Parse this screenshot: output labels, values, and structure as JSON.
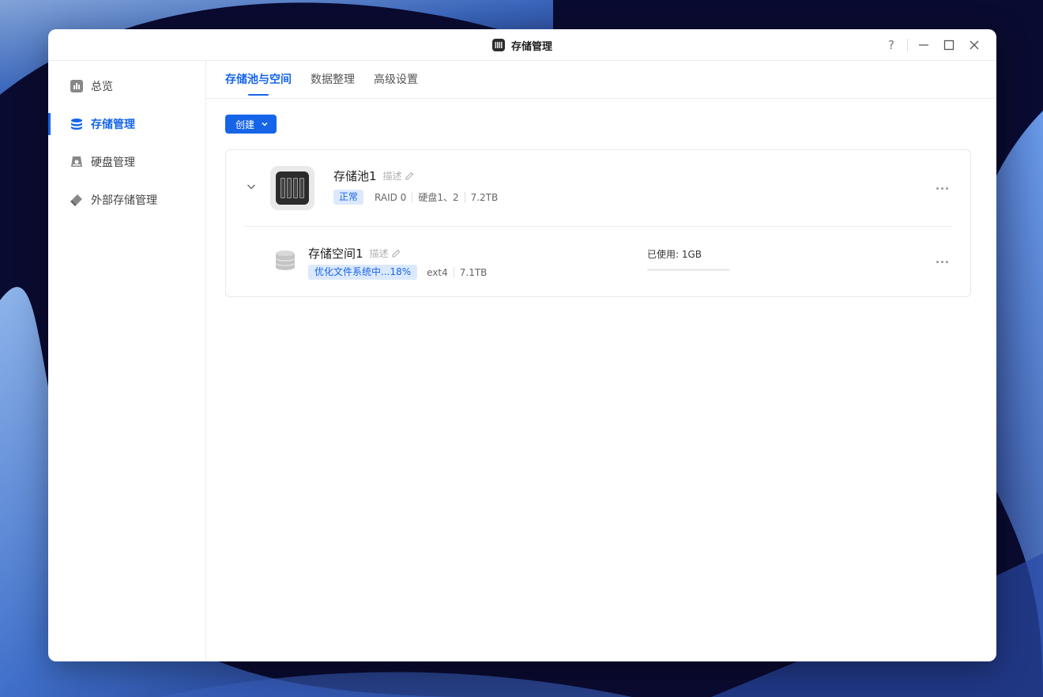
{
  "window": {
    "title": "存储管理",
    "controls": {
      "help": "?"
    }
  },
  "sidebar": {
    "items": [
      {
        "label": "总览",
        "icon": "chart-icon",
        "active": false
      },
      {
        "label": "存储管理",
        "icon": "database-icon",
        "active": true
      },
      {
        "label": "硬盘管理",
        "icon": "disk-icon",
        "active": false
      },
      {
        "label": "外部存储管理",
        "icon": "usb-icon",
        "active": false
      }
    ]
  },
  "tabs": [
    {
      "label": "存储池与空间",
      "active": true
    },
    {
      "label": "数据整理",
      "active": false
    },
    {
      "label": "高级设置",
      "active": false
    }
  ],
  "toolbar": {
    "create_label": "创建"
  },
  "pool": {
    "name": "存储池1",
    "desc_label": "描述",
    "status": "正常",
    "raid": "RAID 0",
    "disks": "硬盘1、2",
    "size": "7.2TB"
  },
  "volume": {
    "name": "存储空间1",
    "desc_label": "描述",
    "status": "优化文件系统中...18%",
    "fs": "ext4",
    "size": "7.1TB",
    "usage_label": "已使用: 1GB",
    "usage_fraction": 0.0
  },
  "colors": {
    "accent": "#1665e8",
    "badge_bg": "#dce9fd"
  }
}
